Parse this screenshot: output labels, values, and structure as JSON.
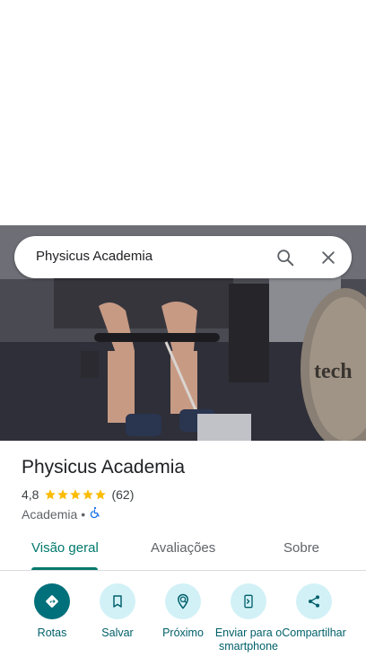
{
  "search": {
    "query": "Physicus Academia"
  },
  "place": {
    "name": "Physicus Academia",
    "rating": "4,8",
    "stars": 5,
    "review_count": "(62)",
    "category": "Academia",
    "separator": "•"
  },
  "tabs": [
    {
      "label": "Visão geral",
      "active": true
    },
    {
      "label": "Avaliações",
      "active": false
    },
    {
      "label": "Sobre",
      "active": false
    }
  ],
  "actions": [
    {
      "label": "Rotas",
      "icon": "directions-icon"
    },
    {
      "label": "Salvar",
      "icon": "bookmark-icon"
    },
    {
      "label": "Próximo",
      "icon": "nearby-icon"
    },
    {
      "label": "Enviar para o smartphone",
      "icon": "send-to-phone-icon"
    },
    {
      "label": "Compartilhar",
      "icon": "share-icon"
    }
  ],
  "colors": {
    "accent": "#00796b",
    "star": "#fbbc04",
    "action_bg": "#d2f1f7",
    "primary_action": "#00707a"
  }
}
